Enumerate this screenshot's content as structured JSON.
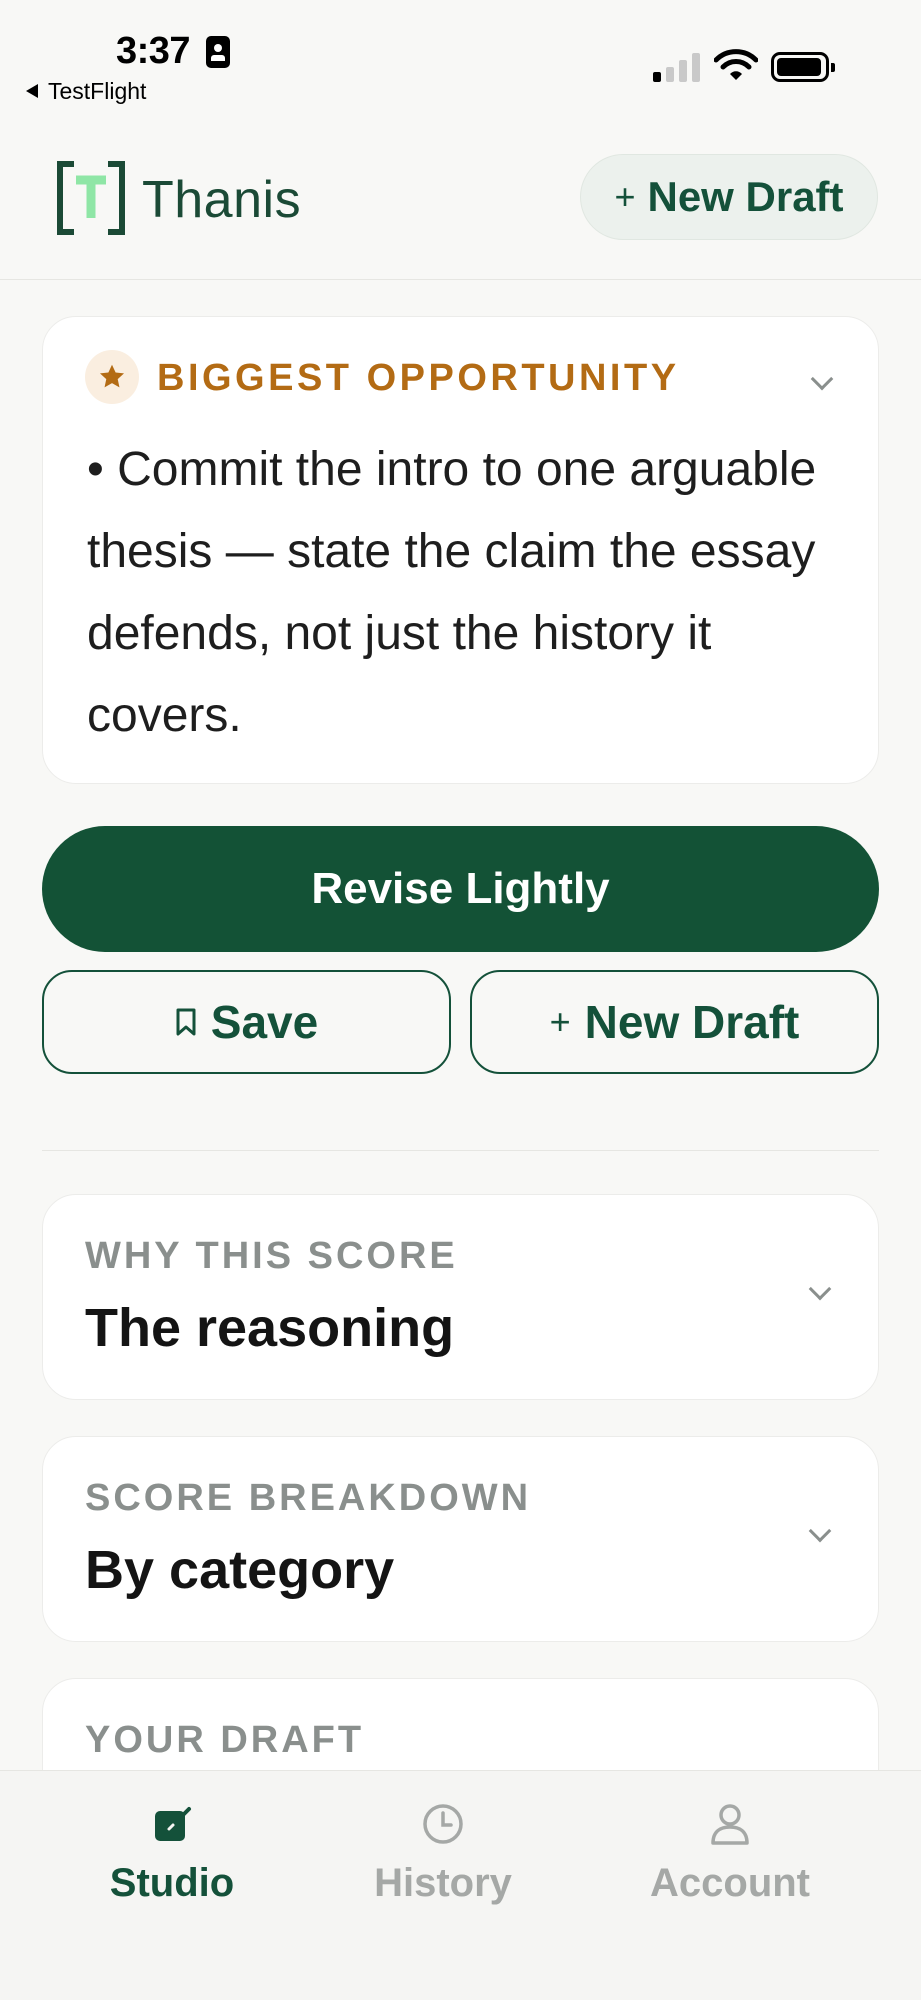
{
  "status_bar": {
    "time": "3:37",
    "back_app": "TestFlight"
  },
  "header": {
    "brand": "Thanis",
    "logo_letter": "T",
    "new_draft_label": "New Draft"
  },
  "opportunity": {
    "title": "BIGGEST OPPORTUNITY",
    "body": "• Commit the intro to one arguable thesis — state the claim the essay defends, not just the history it covers."
  },
  "actions": {
    "revise_label": "Revise Lightly",
    "save_label": "Save",
    "new_draft_label": "New Draft"
  },
  "sections": [
    {
      "label": "WHY THIS SCORE",
      "title": "The reasoning"
    },
    {
      "label": "SCORE BREAKDOWN",
      "title": "By category"
    },
    {
      "label": "YOUR DRAFT",
      "title": ""
    }
  ],
  "tabs": [
    {
      "label": "Studio",
      "icon": "edit-icon",
      "active": true
    },
    {
      "label": "History",
      "icon": "clock-icon",
      "active": false
    },
    {
      "label": "Account",
      "icon": "person-icon",
      "active": false
    }
  ],
  "colors": {
    "brand_green": "#135236",
    "accent_orange": "#b36b14",
    "logo_mint": "#8fe6a6",
    "muted_gray": "#8a8f8d"
  }
}
